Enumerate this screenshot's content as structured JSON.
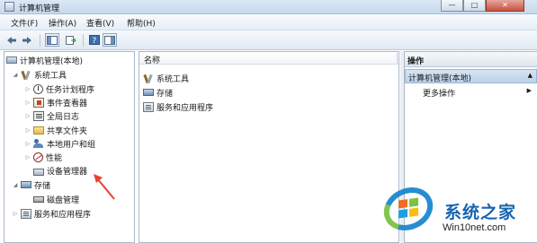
{
  "window": {
    "title": "计算机管理",
    "min_label": "—",
    "max_label": "□",
    "close_label": "✕"
  },
  "menu": [
    {
      "label": "文件(F)"
    },
    {
      "label": "操作(A)"
    },
    {
      "label": "查看(V)"
    },
    {
      "label": "帮助(H)"
    }
  ],
  "toolbar": {
    "back_icon": "back-arrow-icon",
    "forward_icon": "forward-arrow-icon",
    "show_tree_icon": "console-tree-icon",
    "export_icon": "export-list-icon",
    "help_icon": "help-icon",
    "action_pane_icon": "action-pane-icon"
  },
  "tree": {
    "root": "计算机管理(本地)",
    "system_tools": "系统工具",
    "task_scheduler": "任务计划程序",
    "event_viewer": "事件查看器",
    "global_log": "全局日志",
    "shared_folders": "共享文件夹",
    "local_users": "本地用户和组",
    "performance": "性能",
    "device_manager": "设备管理器",
    "storage": "存储",
    "disk_management": "磁盘管理",
    "services_apps": "服务和应用程序"
  },
  "center": {
    "column_header": "名称",
    "items": [
      "系统工具",
      "存储",
      "服务和应用程序"
    ]
  },
  "actions": {
    "title": "操作",
    "section": "计算机管理(本地)",
    "more": "更多操作"
  },
  "watermark": {
    "brand": "系统之家",
    "url": "Win10net.com"
  },
  "colors": {
    "annotation_arrow": "#e8412e",
    "selection": "#cde3f7",
    "brand_blue": "#1565b1"
  }
}
